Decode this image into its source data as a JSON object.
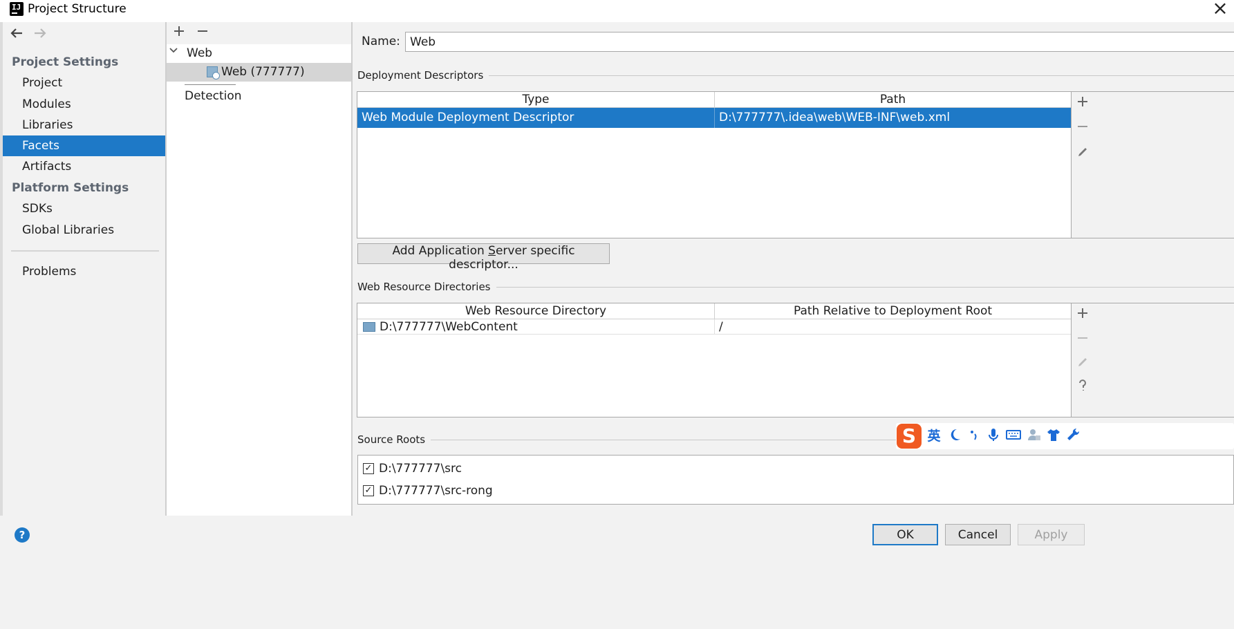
{
  "window": {
    "title": "Project Structure"
  },
  "nav": {
    "project_settings_header": "Project Settings",
    "project_items": [
      {
        "label": "Project"
      },
      {
        "label": "Modules"
      },
      {
        "label": "Libraries"
      },
      {
        "label": "Facets",
        "selected": true
      },
      {
        "label": "Artifacts"
      }
    ],
    "platform_settings_header": "Platform Settings",
    "platform_items": [
      {
        "label": "SDKs"
      },
      {
        "label": "Global Libraries"
      }
    ],
    "problems_label": "Problems"
  },
  "tree": {
    "web_label": "Web",
    "facet_label": "Web (777777)",
    "detection_label": "Detection"
  },
  "facet": {
    "name_label": "Name:",
    "name_value": "Web",
    "deployment_descriptors": {
      "title": "Deployment Descriptors",
      "columns": [
        "Type",
        "Path"
      ],
      "rows": [
        {
          "type": "Web Module Deployment Descriptor",
          "path": "D:\\777777\\.idea\\web\\WEB-INF\\web.xml",
          "selected": true
        }
      ]
    },
    "add_server_descriptor_pre": "Add Application ",
    "add_server_descriptor_mnemonic": "S",
    "add_server_descriptor_post": "erver specific descriptor...",
    "web_resource_directories": {
      "title": "Web Resource Directories",
      "columns": [
        "Web Resource Directory",
        "Path Relative to Deployment Root"
      ],
      "rows": [
        {
          "directory": "D:\\777777\\WebContent",
          "relative": "/"
        }
      ]
    },
    "source_roots": {
      "title": "Source Roots",
      "items": [
        {
          "label": "D:\\777777\\src",
          "checked": true,
          "check_mark": "✓"
        },
        {
          "label": "D:\\777777\\src-rong",
          "checked": true,
          "check_mark": "✓"
        }
      ]
    }
  },
  "ime": {
    "logo": "S",
    "mode": "英",
    "icons": [
      "moon-icon",
      "punctuation-icon",
      "microphone-icon",
      "keyboard-icon",
      "user-icon",
      "skin-icon",
      "wrench-icon"
    ]
  },
  "buttons": {
    "ok": "OK",
    "cancel": "Cancel",
    "apply": "Apply"
  },
  "colors": {
    "selection": "#1e79c7",
    "panel_bg": "#f2f2f2",
    "ime_accent": "#f05a22"
  }
}
